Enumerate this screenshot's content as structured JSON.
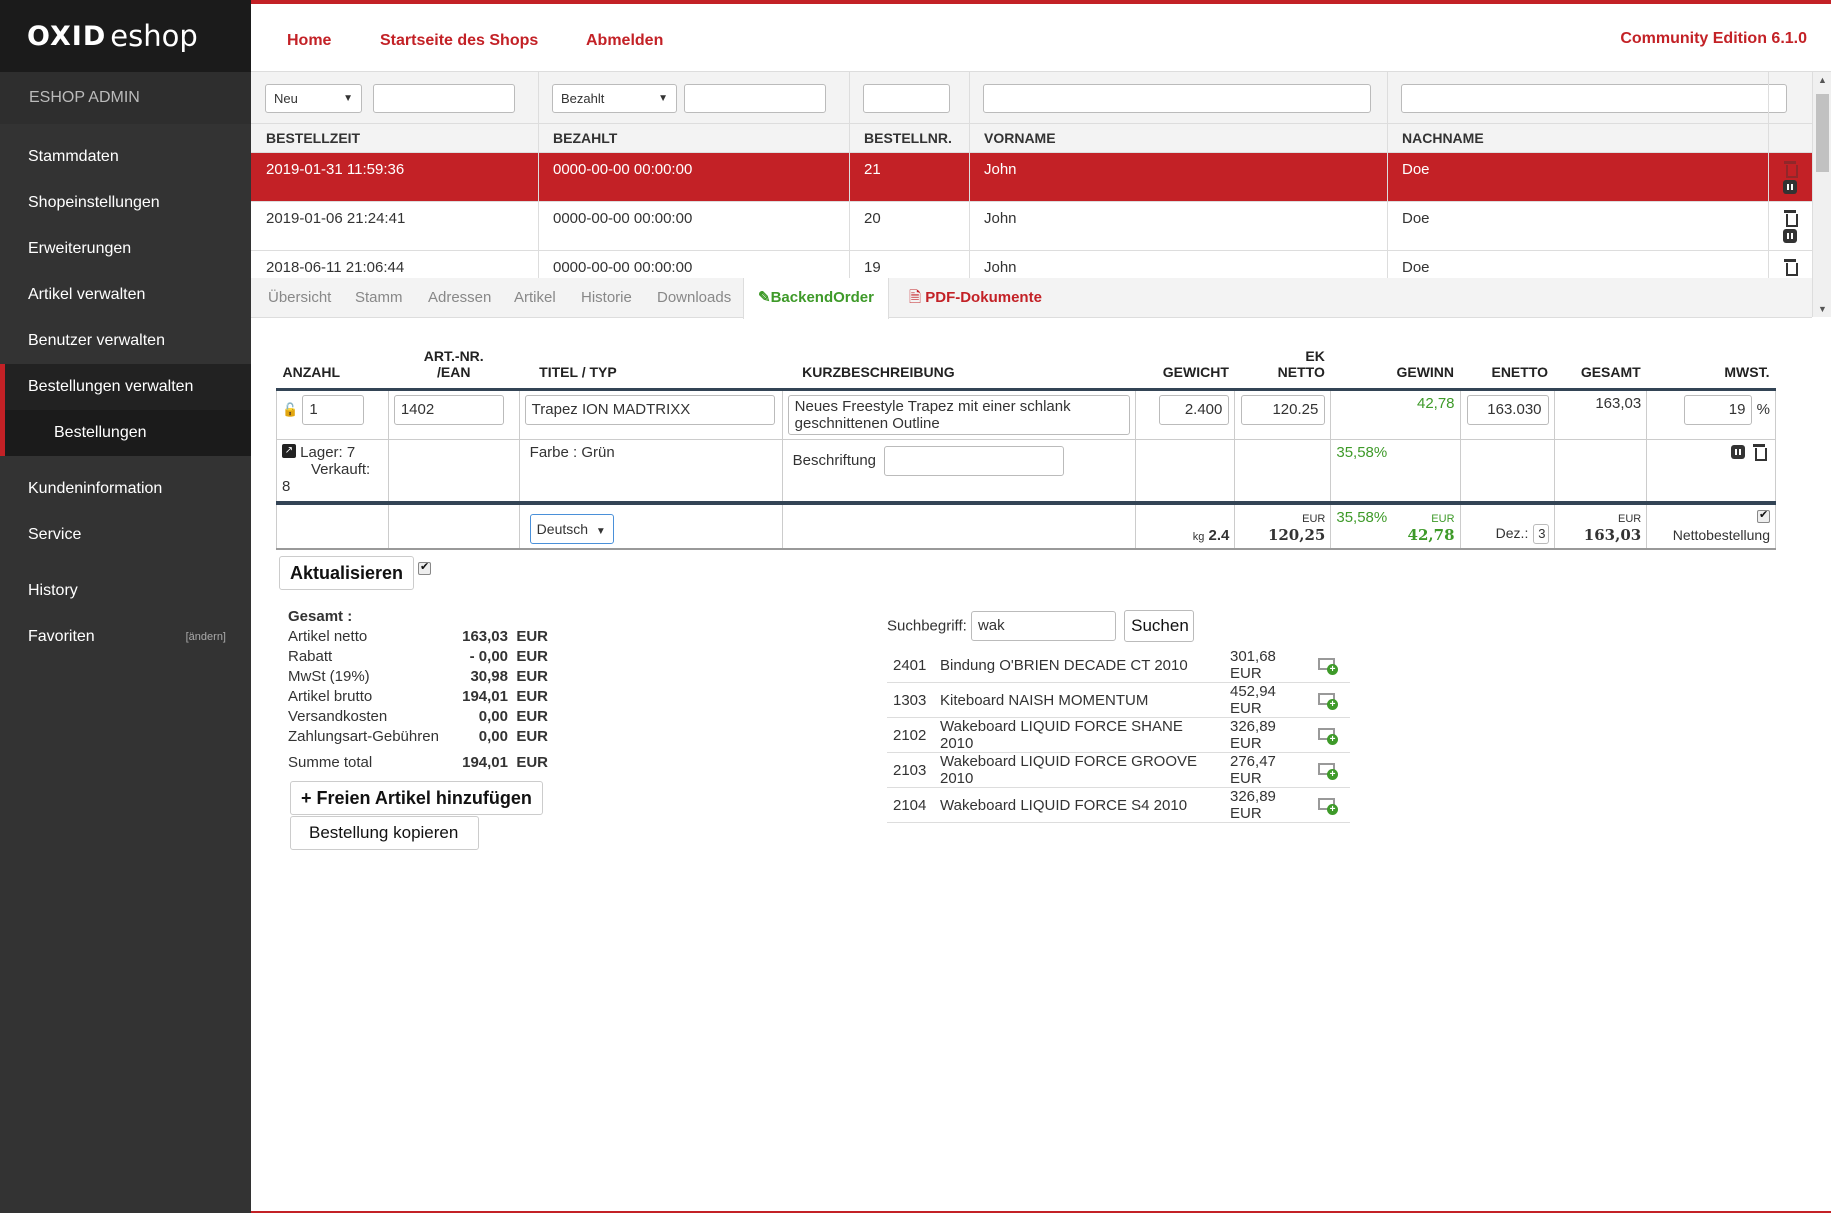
{
  "logo": {
    "brand": "OXID",
    "product": "eshop"
  },
  "sidebar": {
    "title": "ESHOP ADMIN",
    "items": [
      {
        "label": "Stammdaten"
      },
      {
        "label": "Shopeinstellungen"
      },
      {
        "label": "Erweiterungen"
      },
      {
        "label": "Artikel verwalten"
      },
      {
        "label": "Benutzer verwalten"
      },
      {
        "label": "Bestellungen verwalten"
      },
      {
        "label": "Bestellungen"
      },
      {
        "label": "Kundeninformation"
      },
      {
        "label": "Service"
      },
      {
        "label": "History"
      },
      {
        "label": "Favoriten",
        "edit": "[ändern]"
      }
    ]
  },
  "header": {
    "links": [
      "Home",
      "Startseite des Shops",
      "Abmelden"
    ],
    "edition": "Community Edition 6.1.0"
  },
  "filters": {
    "status": "Neu",
    "paid": "Bezahlt"
  },
  "orders": {
    "columns": [
      "BESTELLZEIT",
      "BEZAHLT",
      "BESTELLNR.",
      "VORNAME",
      "NACHNAME"
    ],
    "rows": [
      [
        "2019-01-31 11:59:36",
        "0000-00-00 00:00:00",
        "21",
        "John",
        "Doe"
      ],
      [
        "2019-01-06 21:24:41",
        "0000-00-00 00:00:00",
        "20",
        "John",
        "Doe"
      ],
      [
        "2018-06-11 21:06:44",
        "0000-00-00 00:00:00",
        "19",
        "John",
        "Doe"
      ]
    ]
  },
  "tabs": [
    "Übersicht",
    "Stamm",
    "Adressen",
    "Artikel",
    "Historie",
    "Downloads",
    "BackendOrder",
    "PDF-Dokumente"
  ],
  "items": {
    "columns": {
      "anzahl": "ANZAHL",
      "artnr1": "ART.-NR.",
      "artnr2": "/EAN",
      "titel": "TITEL / TYP",
      "kurz": "KURZBESCHREIBUNG",
      "gewicht": "GEWICHT",
      "ek1": "EK",
      "ek2": "NETTO",
      "gewinn": "GEWINN",
      "enetto": "ENETTO",
      "gesamt": "GESAMT",
      "mwst": "MWST."
    },
    "row": {
      "qty": "1",
      "artnr": "1402",
      "title": "Trapez ION MADTRIXX",
      "short": "Neues Freestyle Trapez mit einer schlank geschnittenen Outline",
      "weight": "2.400",
      "ek": "120.25",
      "profit": "42,78",
      "enetto": "163.030",
      "total": "163,03",
      "vat": "19",
      "vat_unit": "%",
      "stock": "Lager: 7",
      "sold_label": "Verkauft:",
      "sold": "8",
      "variant": "Farbe : Grün",
      "inscription_label": "Beschriftung",
      "profit_pct": "35,58%"
    },
    "sum": {
      "language": "Deutsch",
      "weight_unit": "kg",
      "weight": "2.4",
      "cur": "EUR",
      "ek": "120,25",
      "profit_pct": "35,58%",
      "profit": "42,78",
      "dec_label": "Dez.:",
      "dec": "3",
      "total": "163,03",
      "net_label": "Nettobestellung"
    }
  },
  "buttons": {
    "update": "Aktualisieren",
    "add_free": "+ Freien Artikel hinzufügen",
    "copy": "Bestellung kopieren",
    "search": "Suchen"
  },
  "totals": {
    "heading": "Gesamt :",
    "rows": [
      {
        "label": "Artikel netto",
        "value": "163,03",
        "cur": "EUR"
      },
      {
        "label": "Rabatt",
        "value": "- 0,00",
        "cur": "EUR"
      },
      {
        "label": "MwSt (19%)",
        "value": "30,98",
        "cur": "EUR"
      },
      {
        "label": "Artikel brutto",
        "value": "194,01",
        "cur": "EUR"
      },
      {
        "label": "Versandkosten",
        "value": "0,00",
        "cur": "EUR"
      },
      {
        "label": "Zahlungsart-Gebühren",
        "value": "0,00",
        "cur": "EUR"
      },
      {
        "label": "Summe total",
        "value": "194,01",
        "cur": "EUR"
      }
    ]
  },
  "search": {
    "label": "Suchbegriff:",
    "value": "wak",
    "results": [
      {
        "nr": "2401",
        "title": "Bindung O'BRIEN DECADE CT 2010",
        "price": "301,68 EUR"
      },
      {
        "nr": "1303",
        "title": "Kiteboard NAISH MOMENTUM",
        "price": "452,94 EUR"
      },
      {
        "nr": "2102",
        "title": "Wakeboard LIQUID FORCE SHANE 2010",
        "price": "326,89 EUR"
      },
      {
        "nr": "2103",
        "title": "Wakeboard LIQUID FORCE GROOVE 2010",
        "price": "276,47 EUR"
      },
      {
        "nr": "2104",
        "title": "Wakeboard LIQUID FORCE S4 2010",
        "price": "326,89 EUR"
      }
    ]
  },
  "colors": {
    "brand_red": "#c32126",
    "accent_green": "#3e9a29",
    "sidebar": "#333333"
  }
}
